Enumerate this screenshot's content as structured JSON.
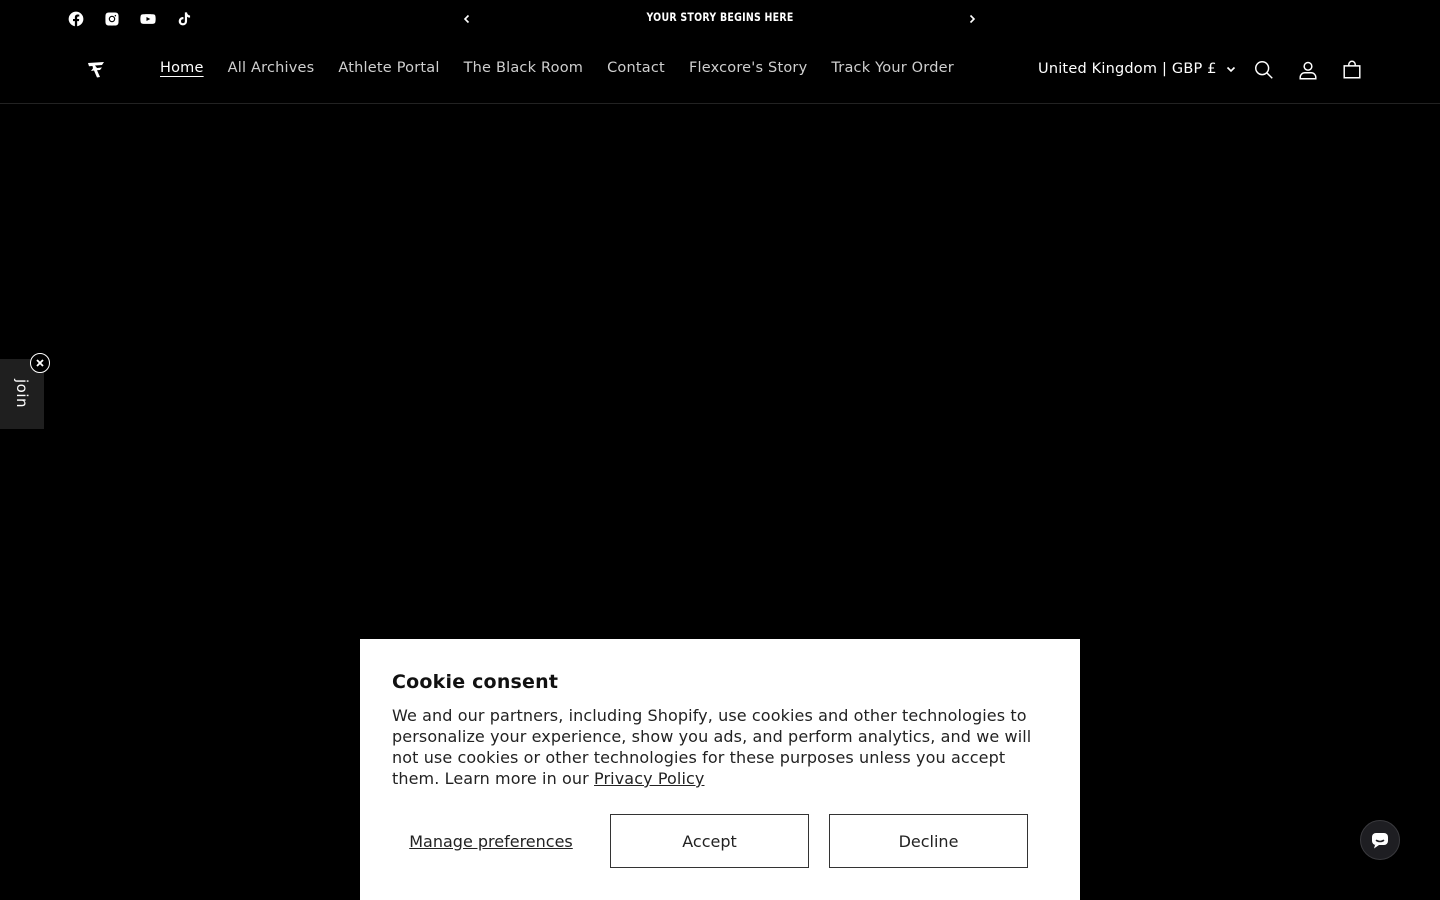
{
  "announcement": {
    "text": "YOUR STORY BEGINS HERE",
    "social": [
      "facebook-icon",
      "instagram-icon",
      "youtube-icon",
      "tiktok-icon"
    ]
  },
  "header": {
    "nav": [
      {
        "label": "Home",
        "active": true
      },
      {
        "label": "All Archives"
      },
      {
        "label": "Athlete Portal"
      },
      {
        "label": "The Black Room"
      },
      {
        "label": "Contact"
      },
      {
        "label": "Flexcore's Story"
      },
      {
        "label": "Track Your Order"
      }
    ],
    "country": "United Kingdom | GBP £"
  },
  "join_tab": {
    "label": "join"
  },
  "cookie": {
    "title": "Cookie consent",
    "body": "We and our partners, including Shopify, use cookies and other technologies to personalize your experience, show you ads, and perform analytics, and we will not use cookies or other technologies for these purposes unless you accept them. Learn more in our",
    "privacy_link": "Privacy Policy",
    "manage_label": "Manage preferences",
    "accept_label": "Accept",
    "decline_label": "Decline"
  },
  "colors": {
    "background": "#000000",
    "text": "#ffffff",
    "cookie_bg": "#ffffff"
  }
}
